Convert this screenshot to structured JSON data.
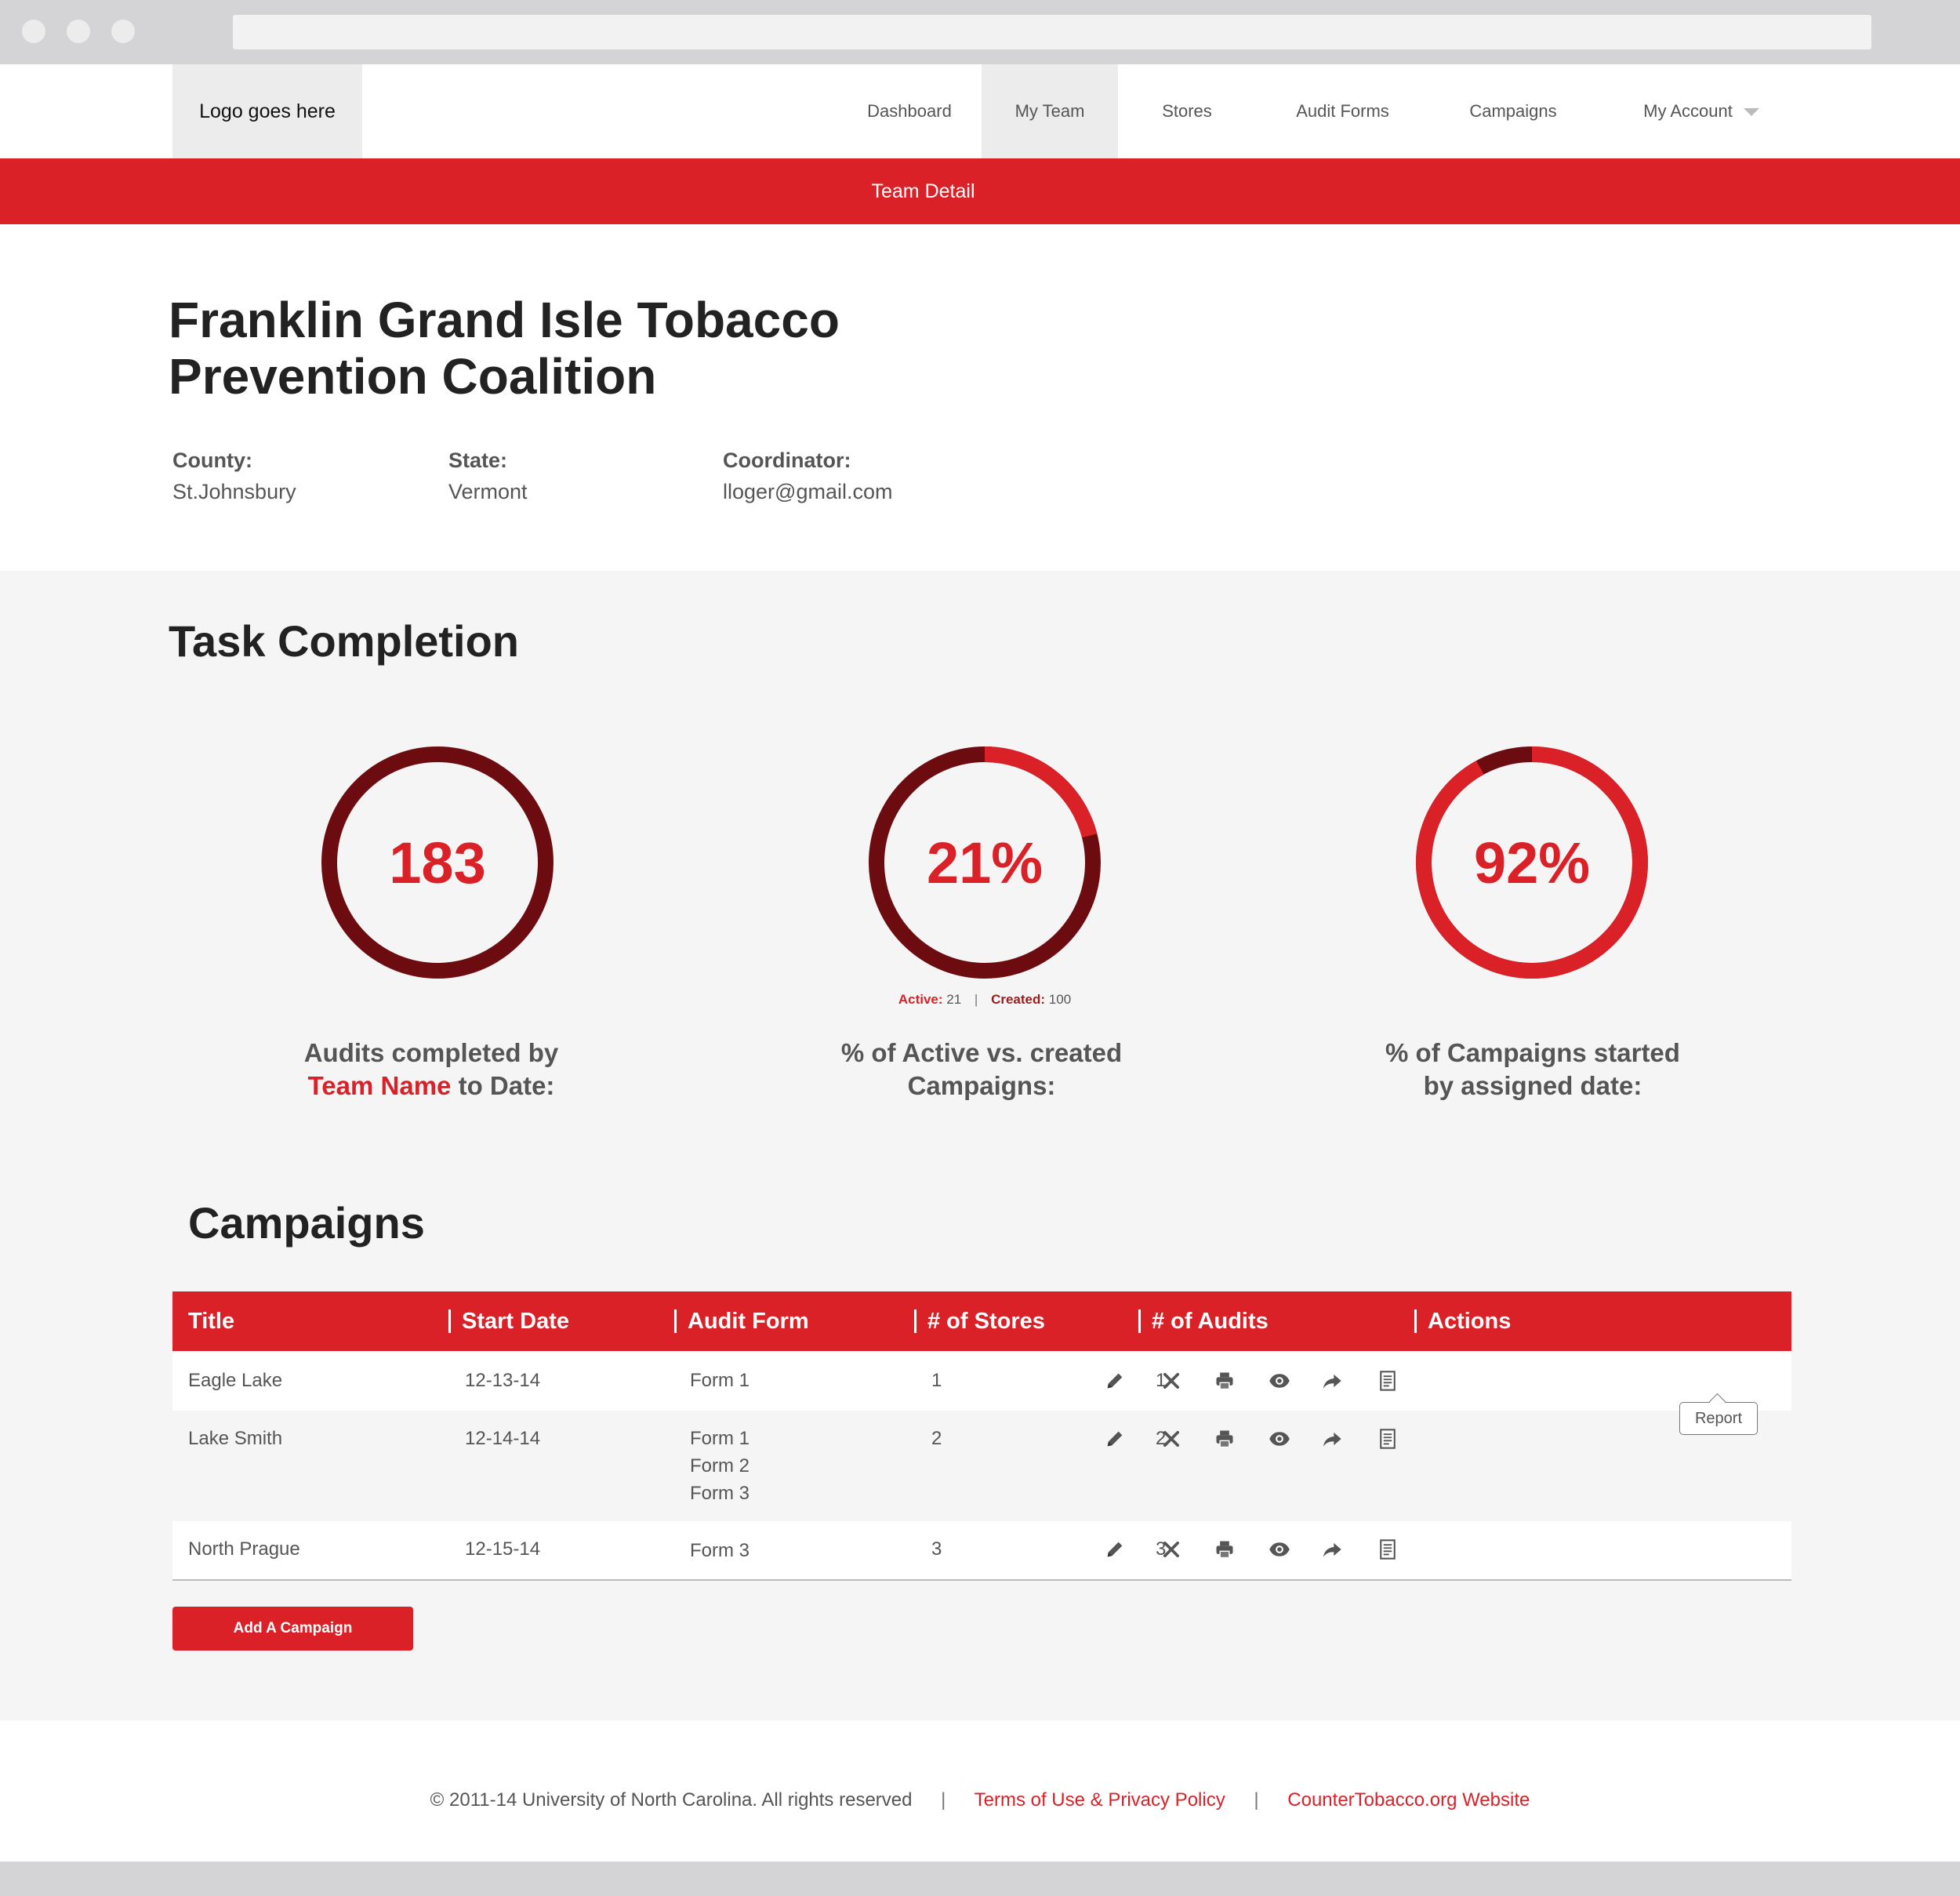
{
  "header": {
    "logo_text": "Logo goes here",
    "nav": [
      {
        "label": "Dashboard"
      },
      {
        "label": "My Team"
      },
      {
        "label": "Stores"
      },
      {
        "label": "Audit Forms"
      },
      {
        "label": "Campaigns"
      },
      {
        "label": "My Account"
      }
    ]
  },
  "banner": {
    "title": "Team Detail"
  },
  "team": {
    "title_line1": "Franklin Grand Isle Tobacco",
    "title_line2": "Prevention Coalition",
    "county_label": "County:",
    "county_value": "St.Johnsbury",
    "state_label": "State:",
    "state_value": "Vermont",
    "coordinator_label": "Coordinator:",
    "coordinator_value": "lloger@gmail.com"
  },
  "task_completion": {
    "title": "Task Completion",
    "metrics": [
      {
        "value_text": "183",
        "fill_fraction": 0,
        "caption_line1": "Audits completed by",
        "caption_accent": "Team Name",
        "caption_rest": " to Date:"
      },
      {
        "value_text": "21%",
        "fill_fraction": 0.21,
        "caption_line1": "% of Active vs. created",
        "caption_line2": "Campaigns:",
        "sub": {
          "active_label": "Active:",
          "active_value": "21",
          "separator": "|",
          "created_label": "Created:",
          "created_value": "100"
        }
      },
      {
        "value_text": "92%",
        "fill_fraction": 0.92,
        "caption_line1": "% of Campaigns started",
        "caption_line2": "by assigned date:"
      }
    ],
    "colors": {
      "accent": "#da2128",
      "dark": "#6d0c10"
    }
  },
  "campaigns": {
    "title": "Campaigns",
    "columns": [
      "Title",
      "Start Date",
      "Audit Form",
      "# of Stores",
      "# of Audits",
      "Actions"
    ],
    "rows": [
      {
        "title": "Eagle Lake",
        "start": "12-13-14",
        "forms": [
          "Form 1"
        ],
        "stores": "1",
        "audits": "1"
      },
      {
        "title": "Lake Smith",
        "start": "12-14-14",
        "forms": [
          "Form 1",
          "Form 2",
          "Form 3"
        ],
        "stores": "2",
        "audits": "2"
      },
      {
        "title": "North Prague",
        "start": "12-15-14",
        "forms": [
          "Form 3"
        ],
        "stores": "3",
        "audits": "3"
      }
    ],
    "action_icons": [
      "pencil-icon",
      "close-icon",
      "printer-icon",
      "eye-icon",
      "share-icon",
      "report-icon"
    ],
    "tooltip": "Report",
    "add_button": "Add A Campaign"
  },
  "footer": {
    "copyright": "© 2011-14 University of North Carolina. All rights reserved",
    "separator": "|",
    "terms_link": "Terms of Use & Privacy Policy",
    "site_link": "CounterTobacco.org Website"
  }
}
